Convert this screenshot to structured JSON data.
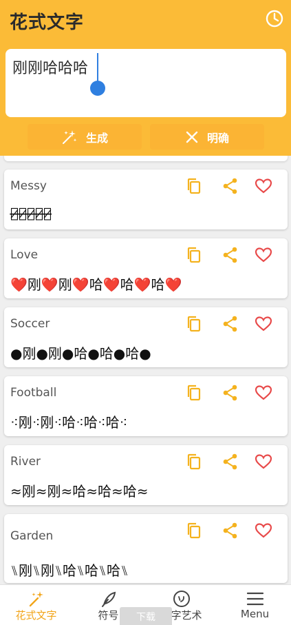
{
  "app": {
    "title": "花式文字"
  },
  "input": {
    "value": "刚刚哈哈哈"
  },
  "actions": {
    "generate_label": "生成",
    "clear_label": "明确"
  },
  "colors": {
    "primary": "#fbbb37",
    "accent_icon": "#f4b21e",
    "heart": "#e84a4a",
    "caret": "#2f7fe0"
  },
  "cards": [
    {
      "name": "Messy",
      "text": "刚̶̷刚̶̷哈̶̷哈̶̷哈̶̷"
    },
    {
      "name": "Love",
      "text": "❤️刚❤️刚❤️哈❤️哈❤️哈❤️"
    },
    {
      "name": "Soccer",
      "text": "●刚●刚●哈●哈●哈●"
    },
    {
      "name": "Football",
      "text": "⁖刚⁖刚⁖哈⁖哈⁖哈⁖"
    },
    {
      "name": "River",
      "text": "≈刚≈刚≈哈≈哈≈哈≈"
    },
    {
      "name": "Garden",
      "text": "⑊刚⑊刚⑊哈⑊哈⑊哈⑊"
    }
  ],
  "nav": {
    "items": [
      {
        "label": "花式文字",
        "icon": "magic-wand-icon",
        "active": true
      },
      {
        "label": "符号",
        "icon": "feather-icon",
        "active": false
      },
      {
        "label": "文字艺术",
        "icon": "smile-face-icon",
        "active": false
      },
      {
        "label": "Menu",
        "icon": "hamburger-menu-icon",
        "active": false
      }
    ]
  },
  "download_tag": "下载"
}
